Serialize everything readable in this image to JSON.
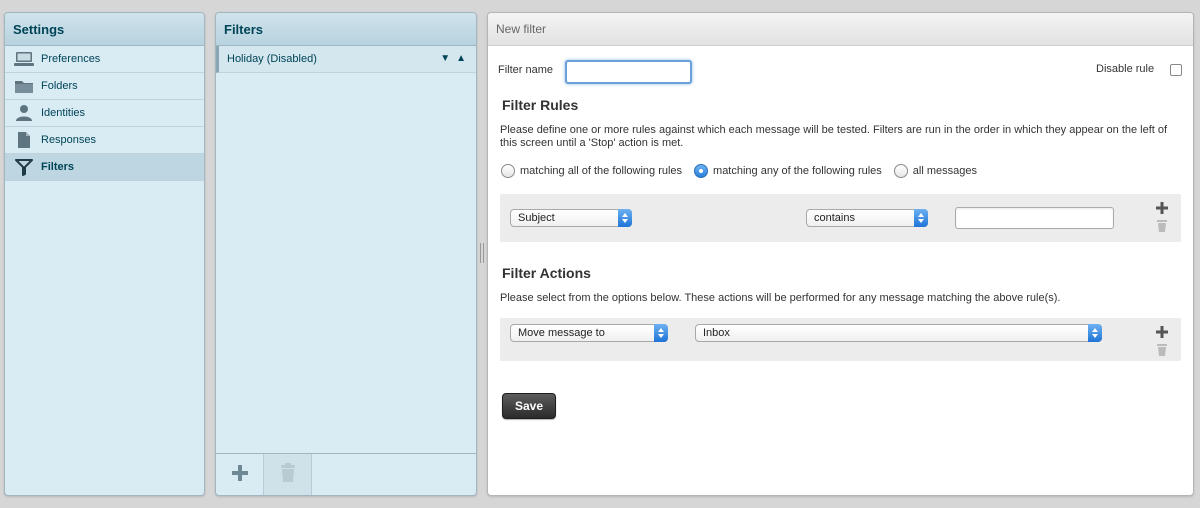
{
  "settings": {
    "title": "Settings",
    "items": [
      {
        "label": "Preferences",
        "icon": "monitor-icon"
      },
      {
        "label": "Folders",
        "icon": "folder-icon"
      },
      {
        "label": "Identities",
        "icon": "person-icon"
      },
      {
        "label": "Responses",
        "icon": "document-icon"
      },
      {
        "label": "Filters",
        "icon": "funnel-icon",
        "active": true
      }
    ]
  },
  "filters": {
    "title": "Filters",
    "items": [
      {
        "label": "Holiday (Disabled)"
      }
    ],
    "footer": {
      "add_icon": "plus-icon",
      "delete_icon": "trash-icon"
    }
  },
  "form": {
    "title": "New filter",
    "filter_name_label": "Filter name",
    "filter_name_value": "",
    "disable_rule_label": "Disable rule",
    "disable_rule_checked": false,
    "rules_title": "Filter Rules",
    "rules_description": "Please define one or more rules against which each message will be tested. Filters are run in the order in which they appear on the left of this screen until a 'Stop' action is met.",
    "match_options": [
      {
        "label": "matching all of the following rules",
        "checked": false
      },
      {
        "label": "matching any of the following rules",
        "checked": true
      },
      {
        "label": "all messages",
        "checked": false
      }
    ],
    "rule": {
      "header_select": "Subject",
      "operator_select": "contains",
      "value": ""
    },
    "actions_title": "Filter Actions",
    "actions_description": "Please select from the options below. These actions will be performed for any message matching the above rule(s).",
    "action": {
      "type_select": "Move message to",
      "target_select": "Inbox"
    },
    "save_label": "Save"
  },
  "colors": {
    "panel_bg": "#d9ebf3",
    "header_text": "#004458",
    "accent_blue": "#2a7fd8"
  }
}
